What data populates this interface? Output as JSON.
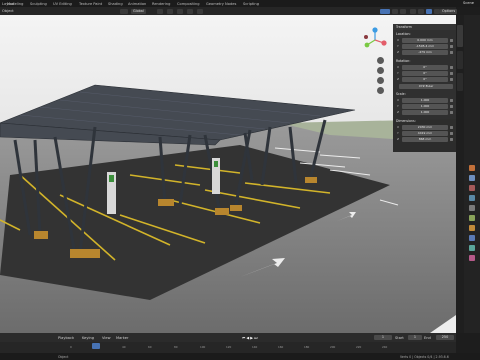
{
  "topbar": {
    "tabs": [
      "Layout",
      "Modeling",
      "Sculpting",
      "UV Editing",
      "Texture Paint",
      "Shading",
      "Animation",
      "Rendering",
      "Compositing",
      "Geometry Nodes",
      "Scripting"
    ],
    "scene": "Scene"
  },
  "header": {
    "left_label": "Object",
    "transform_orientation": "Global",
    "options_label": "Options"
  },
  "npanel": {
    "title": "Transform",
    "location_label": "Location:",
    "location": [
      {
        "axis": "X",
        "value": "0.000 mm"
      },
      {
        "axis": "Y",
        "value": "-1505.4 mm"
      },
      {
        "axis": "Z",
        "value": "-479 mm"
      }
    ],
    "rotation_label": "Rotation:",
    "rotation": [
      {
        "axis": "X",
        "value": "0°"
      },
      {
        "axis": "Y",
        "value": "0°"
      },
      {
        "axis": "Z",
        "value": "0°"
      }
    ],
    "rotation_mode": "XYZ Euler",
    "scale_label": "Scale:",
    "scale": [
      {
        "axis": "X",
        "value": "1.000"
      },
      {
        "axis": "Y",
        "value": "1.000"
      },
      {
        "axis": "Z",
        "value": "1.000"
      }
    ],
    "dimensions_label": "Dimensions:",
    "dimensions": [
      {
        "axis": "X",
        "value": "2030 mm"
      },
      {
        "axis": "Y",
        "value": "4419 mm"
      },
      {
        "axis": "Z",
        "value": "868 mm"
      }
    ]
  },
  "timeline": {
    "playback": "Playback",
    "keying": "Keying",
    "view": "View",
    "marker": "Marker",
    "current_frame": "1",
    "start_label": "Start",
    "start": "1",
    "end_label": "End",
    "end": "250",
    "ticks": [
      "0",
      "20",
      "40",
      "60",
      "80",
      "100",
      "120",
      "140",
      "160",
      "180",
      "200",
      "220",
      "240"
    ]
  },
  "status": {
    "left": "Object",
    "right": "Verts 0 | Objects 0/4 | 2.93.6.6"
  },
  "colors": {
    "accent": "#4772b3",
    "gizmo_x": "#e35d6a",
    "gizmo_y": "#7ac943",
    "gizmo_z": "#3b9be3"
  }
}
